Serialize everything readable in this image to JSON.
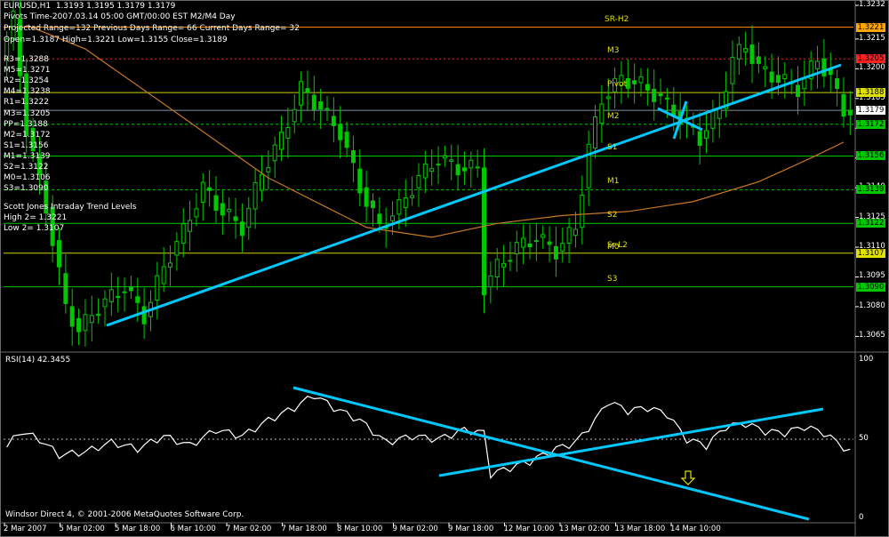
{
  "header": {
    "symbol_line": "EURUSD,H1  1.3193 1.3195 1.3179 1.3179",
    "pivots_time": "Pivots Time-2007.03.14 05:00 GMT/00:00 EST M2/M4 Day",
    "projected_range": "Projected Range=132 Previous Days Range= 66 Current Days Range= 32",
    "ohlc": "Open=1.3187 High=1.3221 Low=1.3155 Close=1.3189"
  },
  "levels_list": [
    "R3=1.3288",
    "M5=1.3271",
    "R2=1.3254",
    "M4=1.3238",
    "R1=1.3222",
    "M3=1.3205",
    "PP=1.3188",
    "M2=1.3172",
    "S1=1.3156",
    "M1=1.3139",
    "S2=1.3122",
    "M0=1.3106",
    "S3=1.3090"
  ],
  "trend_levels": {
    "title": "Scott Jones Intraday Trend Levels",
    "high": "High 2= 1.3221",
    "low": "Low 2= 1.3107"
  },
  "footer": "Windsor Direct 4, © 2001-2006 MetaQuotes Software Corp.",
  "rsi_title": "RSI(14) 42.3455",
  "colors": {
    "background": "#000000",
    "candle": "#00c800",
    "trendline": "#00c8ff",
    "ma": "#c87828",
    "pivot_line": "#00c800",
    "resistance_line": "#ff2020",
    "high_line": "#ff8000",
    "rsi_line": "#ffffff"
  },
  "chart_data": [
    {
      "type": "candlestick",
      "title": "EURUSD,H1",
      "ylim": [
        1.3058,
        1.3232
      ],
      "y_ticks": [
        "1.3232",
        "1.3215",
        "1.3200",
        "1.3185",
        "1.3170",
        "1.3155",
        "1.3140",
        "1.3125",
        "1.3110",
        "1.3095",
        "1.3080",
        "1.3065"
      ],
      "x_ticks": [
        "2 Mar 2007",
        "5 Mar 02:00",
        "5 Mar 18:00",
        "6 Mar 10:00",
        "7 Mar 02:00",
        "7 Mar 18:00",
        "8 Mar 10:00",
        "9 Mar 02:00",
        "9 Mar 18:00",
        "12 Mar 10:00",
        "13 Mar 02:00",
        "13 Mar 18:00",
        "14 Mar 10:00"
      ],
      "price_labels": [
        {
          "value": "1.3221",
          "price": 1.3221,
          "color": "#ffa500"
        },
        {
          "value": "1.3205",
          "price": 1.3205,
          "color": "#ff2020"
        },
        {
          "value": "1.3188",
          "price": 1.3188,
          "color": "#e0e000"
        },
        {
          "value": "1.3179",
          "price": 1.3179,
          "color": "#ffffff"
        },
        {
          "value": "1.3172",
          "price": 1.3172,
          "color": "#00c800"
        },
        {
          "value": "1.3156",
          "price": 1.3156,
          "color": "#00c800"
        },
        {
          "value": "1.3139",
          "price": 1.3139,
          "color": "#00c800"
        },
        {
          "value": "1.3122",
          "price": 1.3122,
          "color": "#00c800"
        },
        {
          "value": "1.3107",
          "price": 1.3107,
          "color": "#e0e000"
        },
        {
          "value": "1.3090",
          "price": 1.309,
          "color": "#00c800"
        }
      ],
      "level_names": [
        {
          "name": "SR-H2",
          "price": 1.3221
        },
        {
          "name": "M3",
          "price": 1.3205
        },
        {
          "name": "Pivot",
          "price": 1.3188
        },
        {
          "name": "M2",
          "price": 1.3172
        },
        {
          "name": "S1",
          "price": 1.3156
        },
        {
          "name": "M1",
          "price": 1.3139
        },
        {
          "name": "S2",
          "price": 1.3122
        },
        {
          "name": "Sr-L2",
          "price": 1.3107
        },
        {
          "name": "M0",
          "price": 1.3106
        },
        {
          "name": "S3",
          "price": 1.309
        }
      ],
      "price_path": [
        [
          0,
          1.3205
        ],
        [
          2,
          1.3225
        ],
        [
          4,
          1.317
        ],
        [
          7,
          1.313
        ],
        [
          10,
          1.308
        ],
        [
          12,
          1.3068
        ],
        [
          15,
          1.308
        ],
        [
          19,
          1.309
        ],
        [
          22,
          1.3075
        ],
        [
          25,
          1.31
        ],
        [
          28,
          1.3118
        ],
        [
          31,
          1.314
        ],
        [
          34,
          1.3128
        ],
        [
          37,
          1.312
        ],
        [
          40,
          1.3148
        ],
        [
          43,
          1.3165
        ],
        [
          46,
          1.319
        ],
        [
          49,
          1.318
        ],
        [
          52,
          1.3168
        ],
        [
          55,
          1.314
        ],
        [
          58,
          1.312
        ],
        [
          61,
          1.313
        ],
        [
          64,
          1.3145
        ],
        [
          67,
          1.3155
        ],
        [
          70,
          1.315
        ],
        [
          73,
          1.315
        ],
        [
          74,
          1.309
        ],
        [
          76,
          1.31
        ],
        [
          79,
          1.311
        ],
        [
          82,
          1.3115
        ],
        [
          85,
          1.3108
        ],
        [
          88,
          1.312
        ],
        [
          90,
          1.316
        ],
        [
          92,
          1.3185
        ],
        [
          95,
          1.3195
        ],
        [
          98,
          1.3192
        ],
        [
          101,
          1.3185
        ],
        [
          104,
          1.3175
        ],
        [
          107,
          1.3165
        ],
        [
          110,
          1.318
        ],
        [
          112,
          1.3205
        ],
        [
          114,
          1.3212
        ],
        [
          116,
          1.32
        ],
        [
          119,
          1.3195
        ],
        [
          122,
          1.319
        ],
        [
          125,
          1.3205
        ],
        [
          127,
          1.3195
        ],
        [
          129,
          1.3179
        ]
      ],
      "moving_average": [
        [
          3,
          1.3222
        ],
        [
          12,
          1.321
        ],
        [
          25,
          1.318
        ],
        [
          40,
          1.3145
        ],
        [
          55,
          1.312
        ],
        [
          65,
          1.3115
        ],
        [
          75,
          1.3122
        ],
        [
          85,
          1.3126
        ],
        [
          95,
          1.3128
        ],
        [
          105,
          1.3133
        ],
        [
          115,
          1.3143
        ],
        [
          123,
          1.3155
        ],
        [
          128,
          1.3163
        ]
      ]
    },
    {
      "type": "line",
      "title": "RSI(14) 42.3455",
      "ylim": [
        0,
        100
      ],
      "y_ticks": [
        "100",
        "50",
        "0"
      ],
      "reference_line": 50,
      "current_value": 42.3455,
      "rsi_path": [
        [
          0,
          45
        ],
        [
          2,
          55
        ],
        [
          5,
          50
        ],
        [
          8,
          40
        ],
        [
          12,
          42
        ],
        [
          16,
          48
        ],
        [
          20,
          44
        ],
        [
          24,
          52
        ],
        [
          28,
          46
        ],
        [
          32,
          56
        ],
        [
          36,
          52
        ],
        [
          40,
          62
        ],
        [
          44,
          70
        ],
        [
          47,
          78
        ],
        [
          50,
          70
        ],
        [
          54,
          62
        ],
        [
          58,
          48
        ],
        [
          62,
          52
        ],
        [
          66,
          50
        ],
        [
          70,
          56
        ],
        [
          73,
          54
        ],
        [
          74,
          28
        ],
        [
          77,
          32
        ],
        [
          80,
          36
        ],
        [
          84,
          44
        ],
        [
          87,
          48
        ],
        [
          90,
          62
        ],
        [
          92,
          74
        ],
        [
          95,
          68
        ],
        [
          98,
          70
        ],
        [
          101,
          66
        ],
        [
          104,
          50
        ],
        [
          107,
          46
        ],
        [
          110,
          58
        ],
        [
          113,
          60
        ],
        [
          116,
          55
        ],
        [
          119,
          54
        ],
        [
          122,
          58
        ],
        [
          125,
          54
        ],
        [
          127,
          48
        ],
        [
          129,
          42
        ]
      ]
    }
  ]
}
